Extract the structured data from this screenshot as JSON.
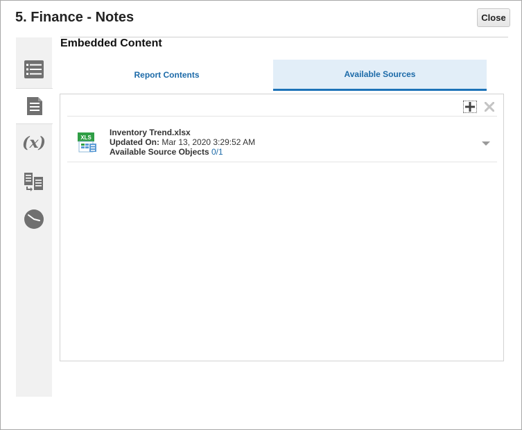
{
  "dialog": {
    "title": "5. Finance - Notes",
    "close_label": "Close"
  },
  "sidebar": {
    "items": [
      {
        "icon": "list-icon"
      },
      {
        "icon": "document-icon",
        "active": true
      },
      {
        "icon": "variable-icon",
        "glyph": "(x)"
      },
      {
        "icon": "copy-transfer-icon"
      },
      {
        "icon": "clock-icon"
      }
    ]
  },
  "section": {
    "title": "Embedded Content"
  },
  "tabs": [
    {
      "label": "Report Contents",
      "selected": false
    },
    {
      "label": "Available Sources",
      "selected": true
    }
  ],
  "toolbar": {
    "add_icon": "plus-icon",
    "remove_icon": "close-x-icon"
  },
  "sources": [
    {
      "file_name": "Inventory Trend.xlsx",
      "file_type_badge": "XLS",
      "updated_label": "Updated On:",
      "updated_value": "Mar 13, 2020 3:29:52 AM",
      "objects_label": "Available Source Objects",
      "objects_value": "0/1"
    }
  ],
  "colors": {
    "accent": "#1c6aa8",
    "tab_selected_bg": "#e2eef8",
    "sidebar_bg": "#f1f1f1",
    "excel_green": "#2f9e45"
  }
}
